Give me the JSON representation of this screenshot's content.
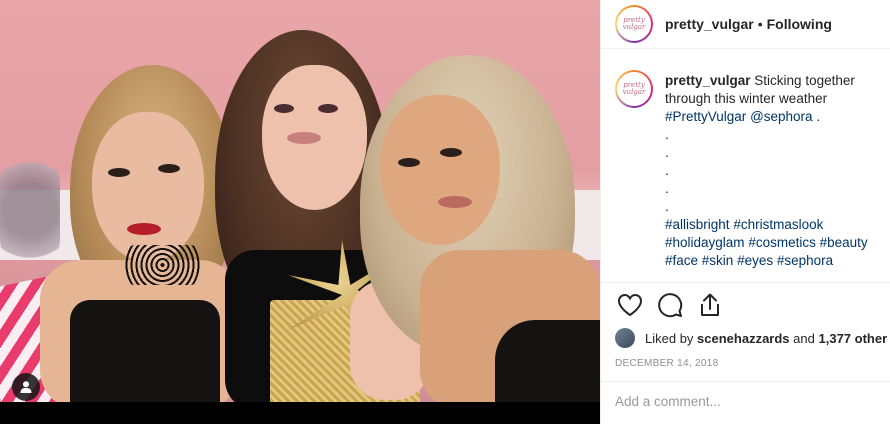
{
  "post": {
    "username": "pretty_vulgar",
    "separator": "•",
    "follow_status": "Following",
    "avatar_text": "pretty vulgar"
  },
  "caption": {
    "username": "pretty_vulgar",
    "text_line1": "Sticking together",
    "text_line2": "through this winter weather",
    "tag_brand": "#PrettyVulgar",
    "mention": "@sephora",
    "trail": ".",
    "dots": [
      ".",
      ".",
      ".",
      ".",
      "."
    ],
    "hashtags_line1": [
      "#allisbright",
      "#christmaslook"
    ],
    "hashtags_line2": [
      "#holidayglam",
      "#cosmetics",
      "#beauty"
    ],
    "hashtags_line3": [
      "#face",
      "#skin",
      "#eyes",
      "#sephora"
    ]
  },
  "actions": {
    "like_icon": "heart-icon",
    "comment_icon": "comment-icon",
    "share_icon": "share-icon"
  },
  "likes": {
    "prefix": "Liked by",
    "user": "scenehazzards",
    "joiner": "and",
    "count": "1,377 other"
  },
  "date": "DECEMBER 14, 2018",
  "comment_input": {
    "placeholder": "Add a comment..."
  },
  "photo": {
    "tag_icon": "user-tag-icon"
  }
}
